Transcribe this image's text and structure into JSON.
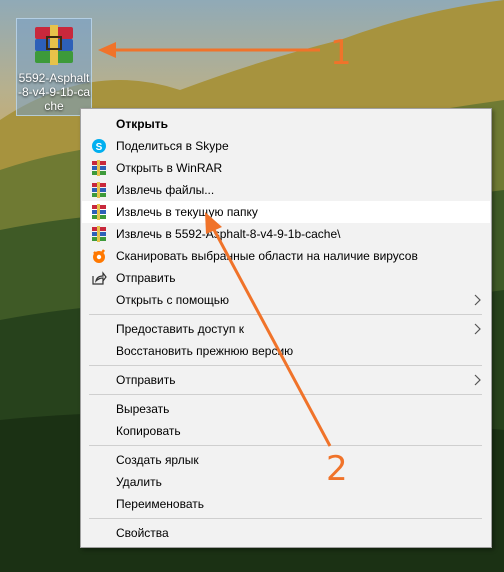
{
  "desktop": {
    "file_icon": {
      "icon": "winrar-archive-icon",
      "label": "5592-Asphalt-8-v4-9-1b-cache"
    }
  },
  "menu": {
    "items": [
      {
        "label": "Открыть",
        "bold": true,
        "icon": "none"
      },
      {
        "label": "Поделиться в Skype",
        "icon": "skype-icon"
      },
      {
        "label": "Открыть в WinRAR",
        "icon": "winrar-icon"
      },
      {
        "label": "Извлечь файлы...",
        "icon": "winrar-icon"
      },
      {
        "label": "Извлечь в текущую папку",
        "icon": "winrar-icon",
        "highlighted": true
      },
      {
        "label": "Извлечь в 5592-Asphalt-8-v4-9-1b-cache\\",
        "icon": "winrar-icon"
      },
      {
        "label": "Сканировать выбранные области на наличие вирусов",
        "icon": "avast-icon"
      },
      {
        "label": "Отправить",
        "icon": "share-icon"
      },
      {
        "label": "Открыть с помощью",
        "icon": "none",
        "submenu": true
      },
      {
        "label": "Предоставить доступ к",
        "icon": "none",
        "submenu": true
      },
      {
        "label": "Восстановить прежнюю версию",
        "icon": "none"
      },
      {
        "label": "Отправить",
        "icon": "none",
        "submenu": true
      },
      {
        "label": "Вырезать",
        "icon": "none"
      },
      {
        "label": "Копировать",
        "icon": "none"
      },
      {
        "label": "Создать ярлык",
        "icon": "none"
      },
      {
        "label": "Удалить",
        "icon": "none"
      },
      {
        "label": "Переименовать",
        "icon": "none"
      },
      {
        "label": "Свойства",
        "icon": "none"
      }
    ]
  },
  "annotations": {
    "step1": "1",
    "step2": "2",
    "color": "#f0732a"
  },
  "colors": {
    "menu_bg": "#f2f2f2",
    "highlight_bg": "#ffffff",
    "skype": "#00aff0",
    "avast": "#ff7800"
  }
}
